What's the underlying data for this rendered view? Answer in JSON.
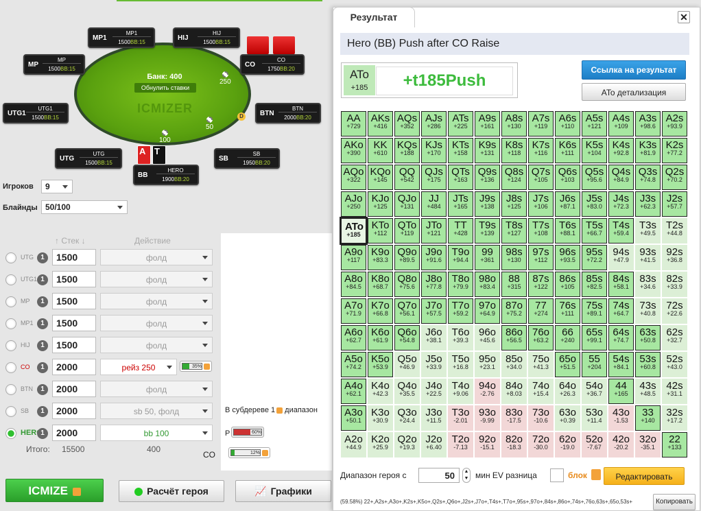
{
  "table": {
    "bank": "Банк: 400",
    "reset": "Обнулить ставки",
    "logo": "ICMIZER",
    "seats": [
      {
        "pos": "MP1",
        "name": "MP1",
        "stack": "1500",
        "bb": "BB:15"
      },
      {
        "pos": "HIJ",
        "name": "HIJ",
        "stack": "1500",
        "bb": "BB:15"
      },
      {
        "pos": "MP",
        "name": "MP",
        "stack": "1500",
        "bb": "BB:15"
      },
      {
        "pos": "CO",
        "name": "CO",
        "stack": "1750",
        "bb": "BB:20"
      },
      {
        "pos": "UTG1",
        "name": "UTG1",
        "stack": "1500",
        "bb": "BB:15"
      },
      {
        "pos": "BTN",
        "name": "BTN",
        "stack": "2000",
        "bb": "BB:20"
      },
      {
        "pos": "UTG",
        "name": "UTG",
        "stack": "1500",
        "bb": "BB:15"
      },
      {
        "pos": "SB",
        "name": "SB",
        "stack": "1950",
        "bb": "BB:20"
      },
      {
        "pos": "BB",
        "name": "HERO",
        "stack": "1900",
        "bb": "BB:20"
      }
    ],
    "chips": [
      "250",
      "50",
      "100"
    ],
    "dealer": "D",
    "cards": [
      "A",
      "T"
    ]
  },
  "settings": {
    "players_label": "Игроков",
    "players": "9",
    "blinds_label": "Блайнды",
    "blinds": "50/100",
    "stack_h": "Стек",
    "action_h": "Действие"
  },
  "rows": [
    {
      "pos": "UTG",
      "n": "1",
      "stack": "1500",
      "act": "фолд"
    },
    {
      "pos": "UTG1",
      "n": "1",
      "stack": "1500",
      "act": "фолд"
    },
    {
      "pos": "MP",
      "n": "1",
      "stack": "1500",
      "act": "фолд"
    },
    {
      "pos": "MP1",
      "n": "1",
      "stack": "1500",
      "act": "фолд"
    },
    {
      "pos": "HIJ",
      "n": "1",
      "stack": "1500",
      "act": "фолд"
    },
    {
      "pos": "CO",
      "n": "1",
      "stack": "2000",
      "act": "рейз 250",
      "pct": "35%"
    },
    {
      "pos": "BTN",
      "n": "1",
      "stack": "2000",
      "act": "фолд"
    },
    {
      "pos": "SB",
      "n": "1",
      "stack": "2000",
      "act": "sb 50, фолд"
    },
    {
      "pos": "HERO",
      "n": "1",
      "stack": "2000",
      "act": "bb 100"
    }
  ],
  "totals": {
    "label": "Итого:",
    "stack": "15500",
    "act": "400"
  },
  "mid": {
    "subtree": "В субдереве 1",
    "subtree2": "диапазон",
    "p_label": "P",
    "p_pct": "60%",
    "pct2": "12%",
    "co": "CO"
  },
  "buttons": {
    "icmize": "ICMIZE",
    "hero": "Расчёт героя",
    "charts": "Графики"
  },
  "result": {
    "tab": "Результат",
    "title": "Hero (BB) Push after CO Raise",
    "hand": "ATo",
    "hand_ev": "+185",
    "big": "+t185Push",
    "link": "Ссылка на результат",
    "detail": "ATo детализация",
    "range_label": "Диапазон героя с",
    "range_val": "50",
    "ev_label": "мин EV разница",
    "block": "блок",
    "edit": "Редактировать",
    "range_text": "(59.58%) 22+,A2s+,A3o+,K2s+,K5o+,Q2s+,Q6o+,J2s+,J7o+,T4s+,T7o+,95s+,97o+,84s+,86o+,74s+,76o,63s+,65o,53s+",
    "copy": "Копировать"
  },
  "grid": [
    [
      [
        "AA",
        "+729",
        "p"
      ],
      [
        "AKs",
        "+416",
        "p"
      ],
      [
        "AQs",
        "+352",
        "p"
      ],
      [
        "AJs",
        "+286",
        "p"
      ],
      [
        "ATs",
        "+225",
        "p"
      ],
      [
        "A9s",
        "+161",
        "p"
      ],
      [
        "A8s",
        "+130",
        "p"
      ],
      [
        "A7s",
        "+119",
        "p"
      ],
      [
        "A6s",
        "+110",
        "p"
      ],
      [
        "A5s",
        "+121",
        "p"
      ],
      [
        "A4s",
        "+109",
        "p"
      ],
      [
        "A3s",
        "+98.6",
        "p"
      ],
      [
        "A2s",
        "+93.9",
        "p"
      ]
    ],
    [
      [
        "AKo",
        "+390",
        "p"
      ],
      [
        "KK",
        "+610",
        "p"
      ],
      [
        "KQs",
        "+188",
        "p"
      ],
      [
        "KJs",
        "+170",
        "p"
      ],
      [
        "KTs",
        "+158",
        "p"
      ],
      [
        "K9s",
        "+131",
        "p"
      ],
      [
        "K8s",
        "+118",
        "p"
      ],
      [
        "K7s",
        "+116",
        "p"
      ],
      [
        "K6s",
        "+111",
        "p"
      ],
      [
        "K5s",
        "+104",
        "p"
      ],
      [
        "K4s",
        "+92.8",
        "p"
      ],
      [
        "K3s",
        "+81.9",
        "p"
      ],
      [
        "K2s",
        "+77.2",
        "p"
      ]
    ],
    [
      [
        "AQo",
        "+322",
        "p"
      ],
      [
        "KQo",
        "+145",
        "p"
      ],
      [
        "QQ",
        "+542",
        "p"
      ],
      [
        "QJs",
        "+175",
        "p"
      ],
      [
        "QTs",
        "+163",
        "p"
      ],
      [
        "Q9s",
        "+136",
        "p"
      ],
      [
        "Q8s",
        "+124",
        "p"
      ],
      [
        "Q7s",
        "+105",
        "p"
      ],
      [
        "Q6s",
        "+103",
        "p"
      ],
      [
        "Q5s",
        "+95.6",
        "p"
      ],
      [
        "Q4s",
        "+84.9",
        "p"
      ],
      [
        "Q3s",
        "+74.8",
        "p"
      ],
      [
        "Q2s",
        "+70.2",
        "p"
      ]
    ],
    [
      [
        "AJo",
        "+250",
        "p"
      ],
      [
        "KJo",
        "+125",
        "p"
      ],
      [
        "QJo",
        "+131",
        "p"
      ],
      [
        "JJ",
        "+484",
        "p"
      ],
      [
        "JTs",
        "+165",
        "p"
      ],
      [
        "J9s",
        "+138",
        "p"
      ],
      [
        "J8s",
        "+125",
        "p"
      ],
      [
        "J7s",
        "+106",
        "p"
      ],
      [
        "J6s",
        "+87.1",
        "p"
      ],
      [
        "J5s",
        "+83.0",
        "p"
      ],
      [
        "J4s",
        "+72.3",
        "p"
      ],
      [
        "J3s",
        "+62.3",
        "p"
      ],
      [
        "J2s",
        "+57.7",
        "p"
      ]
    ],
    [
      [
        "ATo",
        "+185",
        "s"
      ],
      [
        "KTo",
        "+112",
        "p"
      ],
      [
        "QTo",
        "+119",
        "p"
      ],
      [
        "JTo",
        "+121",
        "p"
      ],
      [
        "TT",
        "+428",
        "p"
      ],
      [
        "T9s",
        "+139",
        "p"
      ],
      [
        "T8s",
        "+127",
        "p"
      ],
      [
        "T7s",
        "+108",
        "p"
      ],
      [
        "T6s",
        "+88.1",
        "p"
      ],
      [
        "T5s",
        "+66.7",
        "p"
      ],
      [
        "T4s",
        "+59.4",
        "p"
      ],
      [
        "T3s",
        "+49.5",
        "n"
      ],
      [
        "T2s",
        "+44.8",
        "n"
      ]
    ],
    [
      [
        "A9o",
        "+117",
        "p"
      ],
      [
        "K9o",
        "+83.3",
        "p"
      ],
      [
        "Q9o",
        "+89.5",
        "p"
      ],
      [
        "J9o",
        "+91.6",
        "p"
      ],
      [
        "T9o",
        "+94.4",
        "p"
      ],
      [
        "99",
        "+361",
        "p"
      ],
      [
        "98s",
        "+130",
        "p"
      ],
      [
        "97s",
        "+112",
        "p"
      ],
      [
        "96s",
        "+93.5",
        "p"
      ],
      [
        "95s",
        "+72.2",
        "p"
      ],
      [
        "94s",
        "+47.9",
        "n"
      ],
      [
        "93s",
        "+41.5",
        "n"
      ],
      [
        "92s",
        "+36.8",
        "n"
      ]
    ],
    [
      [
        "A8o",
        "+84.5",
        "p"
      ],
      [
        "K8o",
        "+68.7",
        "p"
      ],
      [
        "Q8o",
        "+75.6",
        "p"
      ],
      [
        "J8o",
        "+77.8",
        "p"
      ],
      [
        "T8o",
        "+79.9",
        "p"
      ],
      [
        "98o",
        "+83.4",
        "p"
      ],
      [
        "88",
        "+315",
        "p"
      ],
      [
        "87s",
        "+122",
        "p"
      ],
      [
        "86s",
        "+105",
        "p"
      ],
      [
        "85s",
        "+82.5",
        "p"
      ],
      [
        "84s",
        "+58.1",
        "p"
      ],
      [
        "83s",
        "+34.6",
        "n"
      ],
      [
        "82s",
        "+33.9",
        "n"
      ]
    ],
    [
      [
        "A7o",
        "+71.9",
        "p"
      ],
      [
        "K7o",
        "+66.8",
        "p"
      ],
      [
        "Q7o",
        "+56.1",
        "p"
      ],
      [
        "J7o",
        "+57.5",
        "p"
      ],
      [
        "T7o",
        "+59.2",
        "p"
      ],
      [
        "97o",
        "+64.9",
        "p"
      ],
      [
        "87o",
        "+75.2",
        "p"
      ],
      [
        "77",
        "+274",
        "p"
      ],
      [
        "76s",
        "+111",
        "p"
      ],
      [
        "75s",
        "+89.1",
        "p"
      ],
      [
        "74s",
        "+64.7",
        "p"
      ],
      [
        "73s",
        "+40.8",
        "n"
      ],
      [
        "72s",
        "+22.6",
        "n"
      ]
    ],
    [
      [
        "A6o",
        "+62.7",
        "p"
      ],
      [
        "K6o",
        "+61.9",
        "p"
      ],
      [
        "Q6o",
        "+54.8",
        "p"
      ],
      [
        "J6o",
        "+38.1",
        "n"
      ],
      [
        "T6o",
        "+39.3",
        "n"
      ],
      [
        "96o",
        "+45.6",
        "n"
      ],
      [
        "86o",
        "+56.5",
        "p"
      ],
      [
        "76o",
        "+63.2",
        "p"
      ],
      [
        "66",
        "+240",
        "p"
      ],
      [
        "65s",
        "+99.1",
        "p"
      ],
      [
        "64s",
        "+74.7",
        "p"
      ],
      [
        "63s",
        "+50.8",
        "p"
      ],
      [
        "62s",
        "+32.7",
        "n"
      ]
    ],
    [
      [
        "A5o",
        "+74.2",
        "p"
      ],
      [
        "K5o",
        "+53.9",
        "p"
      ],
      [
        "Q5o",
        "+46.9",
        "n"
      ],
      [
        "J5o",
        "+33.9",
        "n"
      ],
      [
        "T5o",
        "+16.8",
        "n"
      ],
      [
        "95o",
        "+23.1",
        "n"
      ],
      [
        "85o",
        "+34.0",
        "n"
      ],
      [
        "75o",
        "+41.3",
        "n"
      ],
      [
        "65o",
        "+51.5",
        "p"
      ],
      [
        "55",
        "+204",
        "p"
      ],
      [
        "54s",
        "+84.1",
        "p"
      ],
      [
        "53s",
        "+60.8",
        "p"
      ],
      [
        "52s",
        "+43.0",
        "n"
      ]
    ],
    [
      [
        "A4o",
        "+62.1",
        "p"
      ],
      [
        "K4o",
        "+42.3",
        "n"
      ],
      [
        "Q4o",
        "+35.5",
        "n"
      ],
      [
        "J4o",
        "+22.5",
        "n"
      ],
      [
        "T4o",
        "+9.06",
        "n"
      ],
      [
        "94o",
        "-2.76",
        "r"
      ],
      [
        "84o",
        "+8.03",
        "n"
      ],
      [
        "74o",
        "+15.4",
        "n"
      ],
      [
        "64o",
        "+26.3",
        "n"
      ],
      [
        "54o",
        "+36.7",
        "n"
      ],
      [
        "44",
        "+165",
        "p"
      ],
      [
        "43s",
        "+48.5",
        "n"
      ],
      [
        "42s",
        "+31.1",
        "n"
      ]
    ],
    [
      [
        "A3o",
        "+50.1",
        "p"
      ],
      [
        "K3o",
        "+30.9",
        "n"
      ],
      [
        "Q3o",
        "+24.4",
        "n"
      ],
      [
        "J3o",
        "+11.5",
        "n"
      ],
      [
        "T3o",
        "-2.01",
        "r"
      ],
      [
        "93o",
        "-9.99",
        "r"
      ],
      [
        "83o",
        "-17.5",
        "r"
      ],
      [
        "73o",
        "-10.6",
        "r"
      ],
      [
        "63o",
        "+0.39",
        "n"
      ],
      [
        "53o",
        "+11.4",
        "n"
      ],
      [
        "43o",
        "-1.53",
        "r"
      ],
      [
        "33",
        "+140",
        "p"
      ],
      [
        "32s",
        "+17.2",
        "n"
      ]
    ],
    [
      [
        "A2o",
        "+44.9",
        "n"
      ],
      [
        "K2o",
        "+25.9",
        "n"
      ],
      [
        "Q2o",
        "+19.3",
        "n"
      ],
      [
        "J2o",
        "+6.40",
        "n"
      ],
      [
        "T2o",
        "-7.13",
        "r"
      ],
      [
        "92o",
        "-15.1",
        "r"
      ],
      [
        "82o",
        "-18.3",
        "r"
      ],
      [
        "72o",
        "-30.0",
        "r"
      ],
      [
        "62o",
        "-19.0",
        "r"
      ],
      [
        "52o",
        "-7.67",
        "r"
      ],
      [
        "42o",
        "-20.2",
        "r"
      ],
      [
        "32o",
        "-35.1",
        "r"
      ],
      [
        "22",
        "+133",
        "p"
      ]
    ]
  ]
}
